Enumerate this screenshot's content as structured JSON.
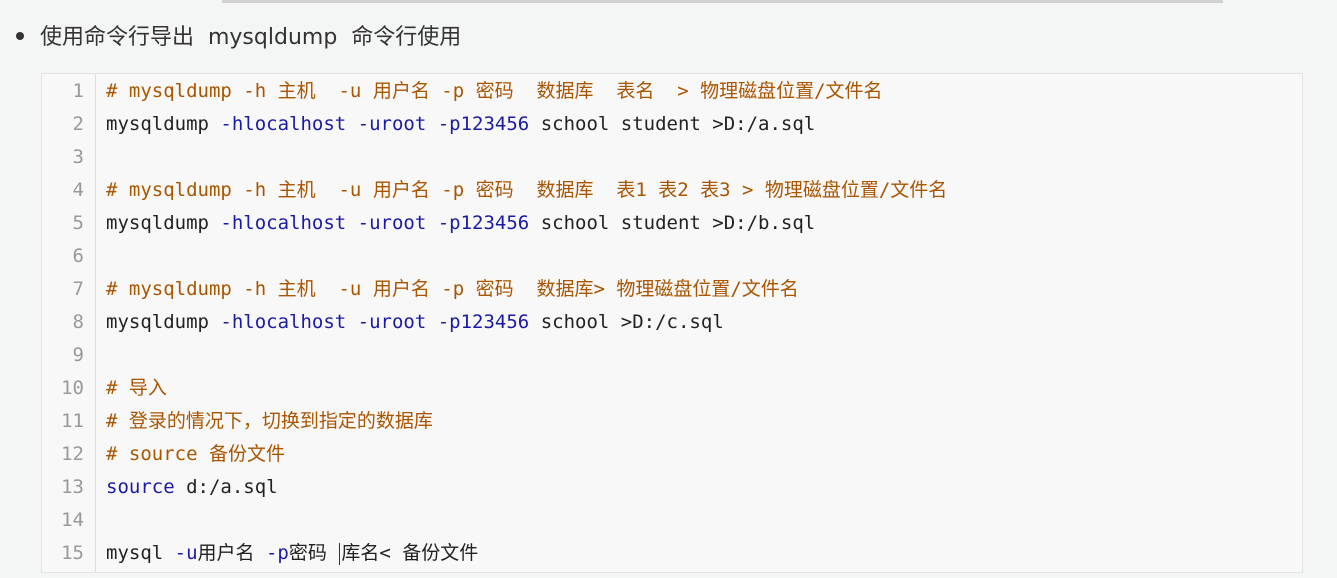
{
  "heading": {
    "text": "使用命令行导出  mysqldump  命令行使用"
  },
  "code_block": {
    "lines": [
      {
        "num": "1",
        "segments": [
          {
            "t": "# mysqldump -h ",
            "c": "cm"
          },
          {
            "t": "主机  ",
            "c": "cm"
          },
          {
            "t": "-u ",
            "c": "cm"
          },
          {
            "t": "用户名 ",
            "c": "cm"
          },
          {
            "t": "-p ",
            "c": "cm"
          },
          {
            "t": "密码  数据库  表名  > 物理磁盘位置/文件名",
            "c": "cm"
          }
        ]
      },
      {
        "num": "2",
        "segments": [
          {
            "t": "mysqldump ",
            "c": "cmd"
          },
          {
            "t": "-hlocalhost -uroot -p123456 ",
            "c": "opt"
          },
          {
            "t": "school student >D:/a.sql",
            "c": "cmd"
          }
        ]
      },
      {
        "num": "3",
        "segments": []
      },
      {
        "num": "4",
        "segments": [
          {
            "t": "# mysqldump -h ",
            "c": "cm"
          },
          {
            "t": "主机  ",
            "c": "cm"
          },
          {
            "t": "-u ",
            "c": "cm"
          },
          {
            "t": "用户名 ",
            "c": "cm"
          },
          {
            "t": "-p ",
            "c": "cm"
          },
          {
            "t": "密码  数据库  表1 表2 表3 > 物理磁盘位置/文件名",
            "c": "cm"
          }
        ]
      },
      {
        "num": "5",
        "segments": [
          {
            "t": "mysqldump ",
            "c": "cmd"
          },
          {
            "t": "-hlocalhost -uroot -p123456 ",
            "c": "opt"
          },
          {
            "t": "school student >D:/b.sql",
            "c": "cmd"
          }
        ]
      },
      {
        "num": "6",
        "segments": []
      },
      {
        "num": "7",
        "segments": [
          {
            "t": "# mysqldump -h ",
            "c": "cm"
          },
          {
            "t": "主机  ",
            "c": "cm"
          },
          {
            "t": "-u ",
            "c": "cm"
          },
          {
            "t": "用户名 ",
            "c": "cm"
          },
          {
            "t": "-p ",
            "c": "cm"
          },
          {
            "t": "密码  数据库> 物理磁盘位置/文件名",
            "c": "cm"
          }
        ]
      },
      {
        "num": "8",
        "segments": [
          {
            "t": "mysqldump ",
            "c": "cmd"
          },
          {
            "t": "-hlocalhost -uroot -p123456 ",
            "c": "opt"
          },
          {
            "t": "school >D:/c.sql",
            "c": "cmd"
          }
        ]
      },
      {
        "num": "9",
        "segments": []
      },
      {
        "num": "10",
        "segments": [
          {
            "t": "# 导入",
            "c": "cm"
          }
        ]
      },
      {
        "num": "11",
        "segments": [
          {
            "t": "# 登录的情况下，切换到指定的数据库",
            "c": "cm"
          }
        ]
      },
      {
        "num": "12",
        "segments": [
          {
            "t": "# source 备份文件",
            "c": "cm"
          }
        ]
      },
      {
        "num": "13",
        "segments": [
          {
            "t": "source ",
            "c": "kw"
          },
          {
            "t": "d:/a.sql",
            "c": "cmd"
          }
        ]
      },
      {
        "num": "14",
        "segments": []
      },
      {
        "num": "15",
        "segments": [
          {
            "t": "mysql ",
            "c": "cmd"
          },
          {
            "t": "-u",
            "c": "opt"
          },
          {
            "t": "用户名 ",
            "c": "cmd"
          },
          {
            "t": "-p",
            "c": "opt"
          },
          {
            "t": "密码 ",
            "c": "cmd"
          },
          {
            "t": "|CURSOR|",
            "c": "cursor"
          },
          {
            "t": "库名< 备份文件",
            "c": "cmd"
          }
        ]
      }
    ]
  },
  "colors": {
    "comment": "#aa5500",
    "option": "#1a1aa6",
    "text": "#222222",
    "line_number": "#999999",
    "code_bg": "#f8f8f8",
    "page_bg": "#f4f5f5"
  }
}
